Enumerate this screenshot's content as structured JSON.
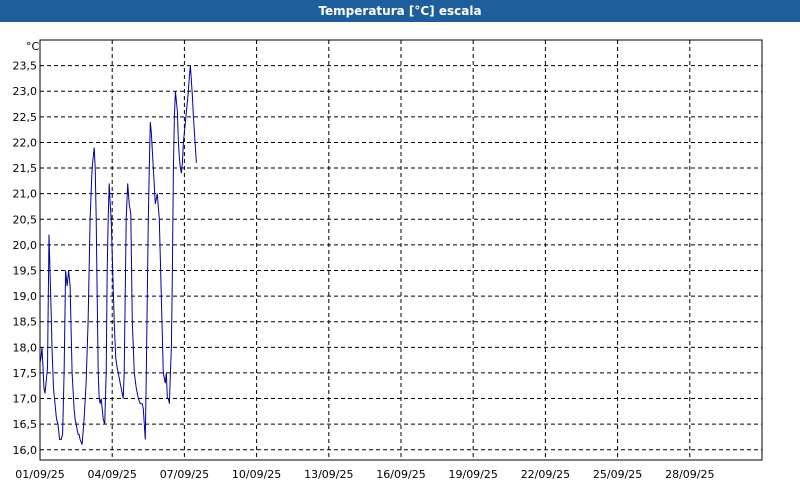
{
  "window": {
    "title": "Temperatura [°C] escala"
  },
  "colors": {
    "titlebar": "#1f5e9c",
    "series": "#0000a0",
    "grid": "#000000"
  },
  "chart_data": {
    "type": "line",
    "title": "Temperatura [°C] escala",
    "ylabel": "°C",
    "xlabel": "",
    "ylim": [
      15.8,
      24.0
    ],
    "yticks": [
      16.0,
      16.5,
      17.0,
      17.5,
      18.0,
      18.5,
      19.0,
      19.5,
      20.0,
      20.5,
      21.0,
      21.5,
      22.0,
      22.5,
      23.0,
      23.5
    ],
    "ytick_labels": [
      "16,0",
      "16,5",
      "17,0",
      "17,5",
      "18,0",
      "18,5",
      "19,0",
      "19,5",
      "20,0",
      "20,5",
      "21,0",
      "21,5",
      "22,0",
      "22,5",
      "23,0",
      "23,5"
    ],
    "xlim": [
      "2025-09-01",
      "2025-09-31"
    ],
    "xticks": [
      "2025-09-01",
      "2025-09-04",
      "2025-09-07",
      "2025-09-10",
      "2025-09-13",
      "2025-09-16",
      "2025-09-19",
      "2025-09-22",
      "2025-09-25",
      "2025-09-28"
    ],
    "xtick_labels": [
      "01/09/25",
      "04/09/25",
      "07/09/25",
      "10/09/25",
      "13/09/25",
      "16/09/25",
      "19/09/25",
      "22/09/25",
      "25/09/25",
      "28/09/25"
    ],
    "grid": true,
    "series": [
      {
        "color": "#0000a0",
        "x": [
          "2025-09-01 00:00",
          "2025-09-01 01:00",
          "2025-09-01 02:00",
          "2025-09-01 03:00",
          "2025-09-01 04:00",
          "2025-09-01 05:00",
          "2025-09-01 06:00",
          "2025-09-01 07:30",
          "2025-09-01 09:00",
          "2025-09-01 10:00",
          "2025-09-01 11:00",
          "2025-09-01 12:00",
          "2025-09-01 13:30",
          "2025-09-01 15:00",
          "2025-09-01 16:30",
          "2025-09-01 18:00",
          "2025-09-01 19:30",
          "2025-09-01 21:00",
          "2025-09-01 22:30",
          "2025-09-02 00:00",
          "2025-09-02 01:30",
          "2025-09-02 03:00",
          "2025-09-02 04:30",
          "2025-09-02 06:00",
          "2025-09-02 08:00",
          "2025-09-02 10:00",
          "2025-09-02 11:00",
          "2025-09-02 12:00",
          "2025-09-02 13:00",
          "2025-09-02 14:00",
          "2025-09-02 15:00",
          "2025-09-02 16:00",
          "2025-09-02 18:00",
          "2025-09-02 20:00",
          "2025-09-02 22:00",
          "2025-09-03 00:00",
          "2025-09-03 02:00",
          "2025-09-03 04:00",
          "2025-09-03 06:00",
          "2025-09-03 07:00",
          "2025-09-03 08:00",
          "2025-09-03 09:00",
          "2025-09-03 10:00",
          "2025-09-03 11:00",
          "2025-09-03 12:00",
          "2025-09-03 13:00",
          "2025-09-03 14:00",
          "2025-09-03 15:00",
          "2025-09-03 16:30",
          "2025-09-03 18:00",
          "2025-09-03 19:00",
          "2025-09-03 20:00",
          "2025-09-03 21:00",
          "2025-09-03 22:00",
          "2025-09-03 23:00",
          "2025-09-04 00:30",
          "2025-09-04 02:00",
          "2025-09-04 03:30",
          "2025-09-04 05:00",
          "2025-09-04 06:00",
          "2025-09-04 07:00",
          "2025-09-04 08:00",
          "2025-09-04 09:00",
          "2025-09-04 10:00",
          "2025-09-04 11:00",
          "2025-09-04 12:00",
          "2025-09-04 13:00",
          "2025-09-04 14:00",
          "2025-09-04 15:30",
          "2025-09-04 17:00",
          "2025-09-04 18:30",
          "2025-09-04 20:00",
          "2025-09-04 22:00",
          "2025-09-05 00:00",
          "2025-09-05 02:00",
          "2025-09-05 04:00",
          "2025-09-05 06:00",
          "2025-09-05 07:00",
          "2025-09-05 08:00",
          "2025-09-05 09:00",
          "2025-09-05 10:00",
          "2025-09-05 11:00",
          "2025-09-05 12:00",
          "2025-09-05 13:00",
          "2025-09-05 14:00",
          "2025-09-05 15:00",
          "2025-09-05 17:00",
          "2025-09-05 19:00",
          "2025-09-05 21:00",
          "2025-09-05 23:00",
          "2025-09-06 01:00",
          "2025-09-06 03:00",
          "2025-09-06 04:00",
          "2025-09-06 05:00",
          "2025-09-06 06:00",
          "2025-09-06 07:00",
          "2025-09-06 08:00",
          "2025-09-06 09:00",
          "2025-09-06 10:00",
          "2025-09-06 11:00",
          "2025-09-06 12:00",
          "2025-09-06 13:00",
          "2025-09-06 14:00",
          "2025-09-06 15:00",
          "2025-09-06 16:00",
          "2025-09-06 17:00",
          "2025-09-06 18:00",
          "2025-09-06 19:00",
          "2025-09-06 20:00",
          "2025-09-06 21:00",
          "2025-09-06 22:00",
          "2025-09-06 23:00",
          "2025-09-07 00:00",
          "2025-09-07 01:00",
          "2025-09-07 02:00",
          "2025-09-07 03:00",
          "2025-09-07 04:00",
          "2025-09-07 05:00",
          "2025-09-07 06:00",
          "2025-09-07 07:00",
          "2025-09-07 08:00",
          "2025-09-07 09:00",
          "2025-09-07 10:00",
          "2025-09-07 11:00",
          "2025-09-07 12:00"
        ],
        "y": [
          17.7,
          17.8,
          18.0,
          17.6,
          17.2,
          17.1,
          17.3,
          17.6,
          20.2,
          19.5,
          18.8,
          18.0,
          17.2,
          16.9,
          16.6,
          16.5,
          16.2,
          16.2,
          16.3,
          17.5,
          19.5,
          19.2,
          19.5,
          19.2,
          17.5,
          16.8,
          16.6,
          16.5,
          16.4,
          16.3,
          16.3,
          16.2,
          16.1,
          16.6,
          17.3,
          18.5,
          20.5,
          21.5,
          21.9,
          21.5,
          20.5,
          19.0,
          17.5,
          17.0,
          16.9,
          17.0,
          16.8,
          16.6,
          16.5,
          17.5,
          19.5,
          20.5,
          21.2,
          20.8,
          20.5,
          19.5,
          18.5,
          17.8,
          17.6,
          17.5,
          17.4,
          17.3,
          17.2,
          17.1,
          17.0,
          17.5,
          19.0,
          20.5,
          21.2,
          20.8,
          20.6,
          18.5,
          17.5,
          17.2,
          17.0,
          16.9,
          16.9,
          16.8,
          16.5,
          16.2,
          17.5,
          19.0,
          20.5,
          21.5,
          22.4,
          22.2,
          21.5,
          20.8,
          21.0,
          20.5,
          19.0,
          17.5,
          17.4,
          17.3,
          17.5,
          17.0,
          17.0,
          16.9,
          17.5,
          18.0,
          19.5,
          21.5,
          22.5,
          23.0,
          22.8,
          22.6,
          22.0,
          21.7,
          21.5,
          21.4,
          21.6,
          22.0,
          22.2,
          22.4,
          22.6,
          22.8,
          23.0,
          23.3,
          23.5,
          23.2,
          22.9,
          22.5,
          22.2,
          21.9,
          21.6
        ]
      }
    ]
  }
}
